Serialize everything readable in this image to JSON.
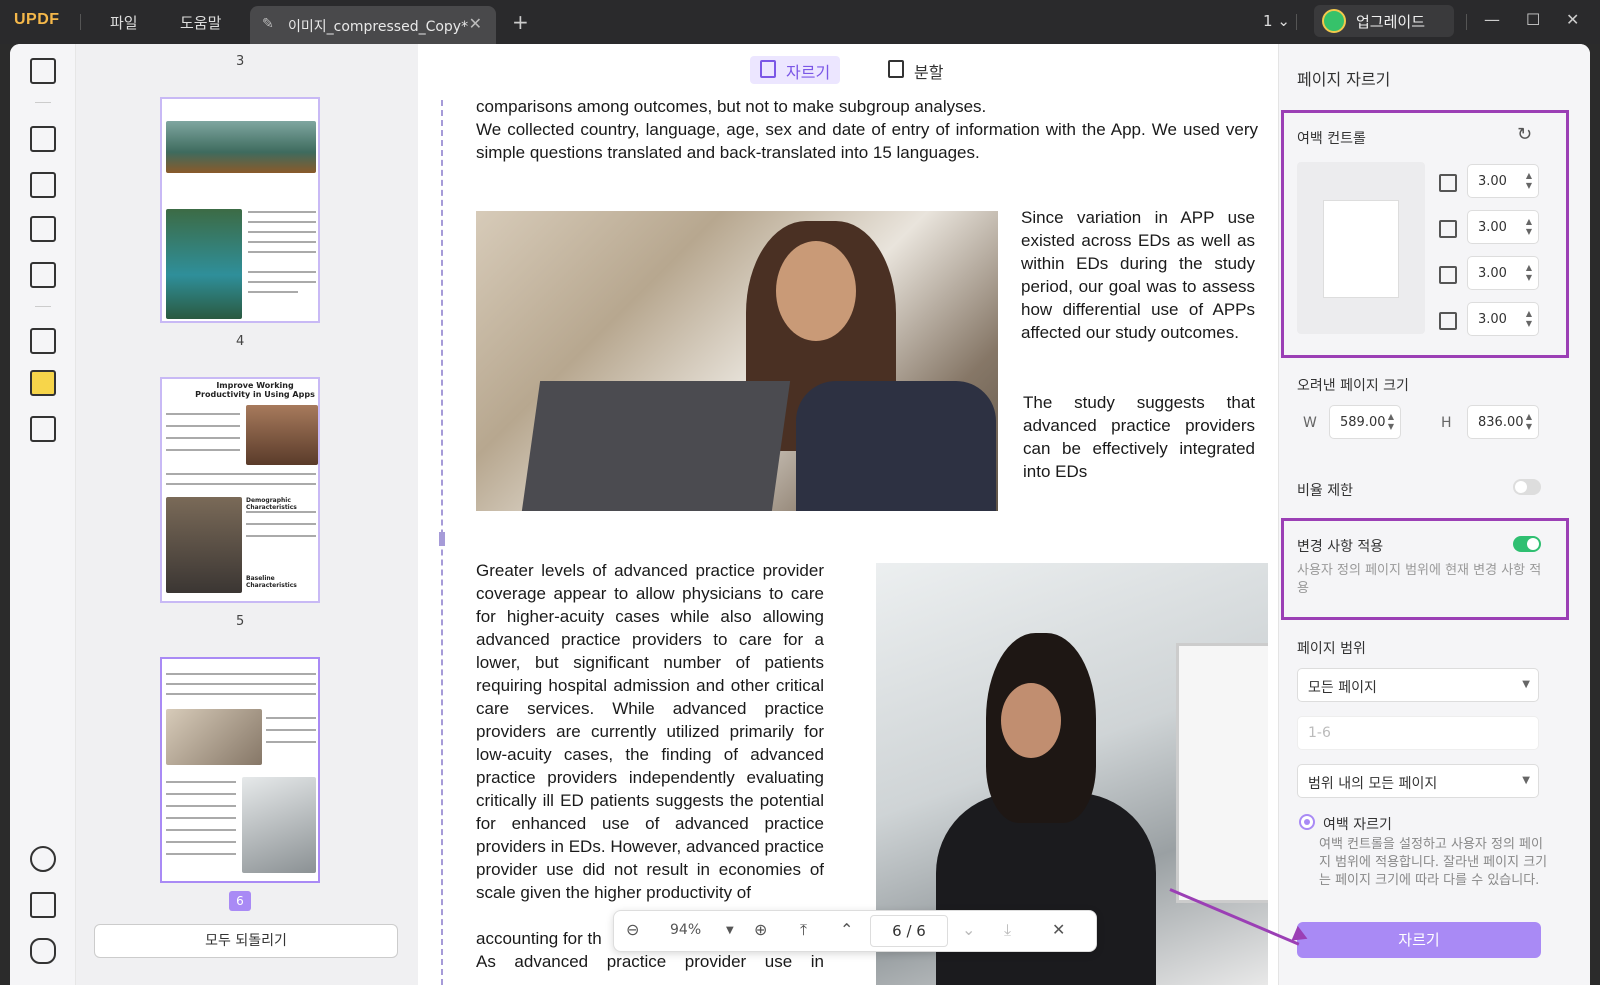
{
  "titlebar": {
    "logo": "UPDF",
    "menu_file": "파일",
    "menu_help": "도움말",
    "tab_title": "이미지_compressed_Copy*",
    "page_selector": "1",
    "upgrade_label": "업그레이드"
  },
  "thumbnails": {
    "page_labels": [
      "3",
      "4",
      "5",
      "6"
    ],
    "thumb5_title": "Improve Working Productivity in Using Apps",
    "thumb5_section1": "Demographic Characteristics",
    "thumb5_section2": "Baseline Characteristics",
    "reset_all": "모두 되돌리기"
  },
  "doc_toolbar": {
    "crop_label": "자르기",
    "split_label": "분할"
  },
  "document": {
    "para_top": "comparisons among outcomes, but not to make subgroup analyses.\nWe collected country, language, age, sex and date of entry of information with the App. We used very simple questions translated and back-translated into 15 languages.",
    "para_right1": "Since variation in APP use existed across EDs as well as within EDs during the study period, our goal was to assess how differential use of APPs affected our study outcomes.",
    "para_right2": "The study suggests that advanced practice providers can be effectively integrated into EDs",
    "para_left": "Greater levels of advanced practice provider coverage appear to allow physicians to care for higher-acuity cases while also allowing advanced practice providers to care for a lower, but significant number of patients requiring hospital admission and other critical care services. While advanced practice providers are currently utilized primarily for low-acuity cases, the finding of advanced practice providers independently evaluating critically ill ED patients suggests the potential for enhanced use of advanced practice providers in EDs. However, advanced practice provider use did not result in economies of scale given the higher productivity of",
    "para_left_tail1": "accounting for th",
    "para_left_tail2": "As advanced practice provider use in"
  },
  "zoom": {
    "level": "94%",
    "page_display": "6 / 6"
  },
  "panel": {
    "title": "페이지 자르기",
    "margin_control": "여백 컨트롤",
    "margin_top": "3.00",
    "margin_bottom": "3.00",
    "margin_left": "3.00",
    "margin_right": "3.00",
    "crop_size_label": "오려낸 페이지 크기",
    "w_label": "W",
    "w_value": "589.00",
    "h_label": "H",
    "h_value": "836.00",
    "ratio_label": "비율 제한",
    "ratio_enabled": false,
    "apply_label": "변경 사항 적용",
    "apply_enabled": true,
    "apply_desc": "사용자 정의 페이지 범위에 현재 변경 사항 적용",
    "page_range_label": "페이지 범위",
    "page_range_value": "모든 페이지",
    "range_placeholder": "1-6",
    "range_subset": "범위 내의 모든 페이지",
    "margin_crop_label": "여백 자르기",
    "margin_crop_desc": "여백 컨트롤을 설정하고 사용자 정의 페이지 범위에 적용합니다. 잘라낸 페이지 크기는 페이지 크기에 따라 다를 수 있습니다.",
    "crop_button": "자르기"
  },
  "colors": {
    "accent": "#a98af5",
    "highlight": "#9b3fb5",
    "toggle_on": "#2fbf71",
    "titlebar": "#2a2a2c"
  }
}
